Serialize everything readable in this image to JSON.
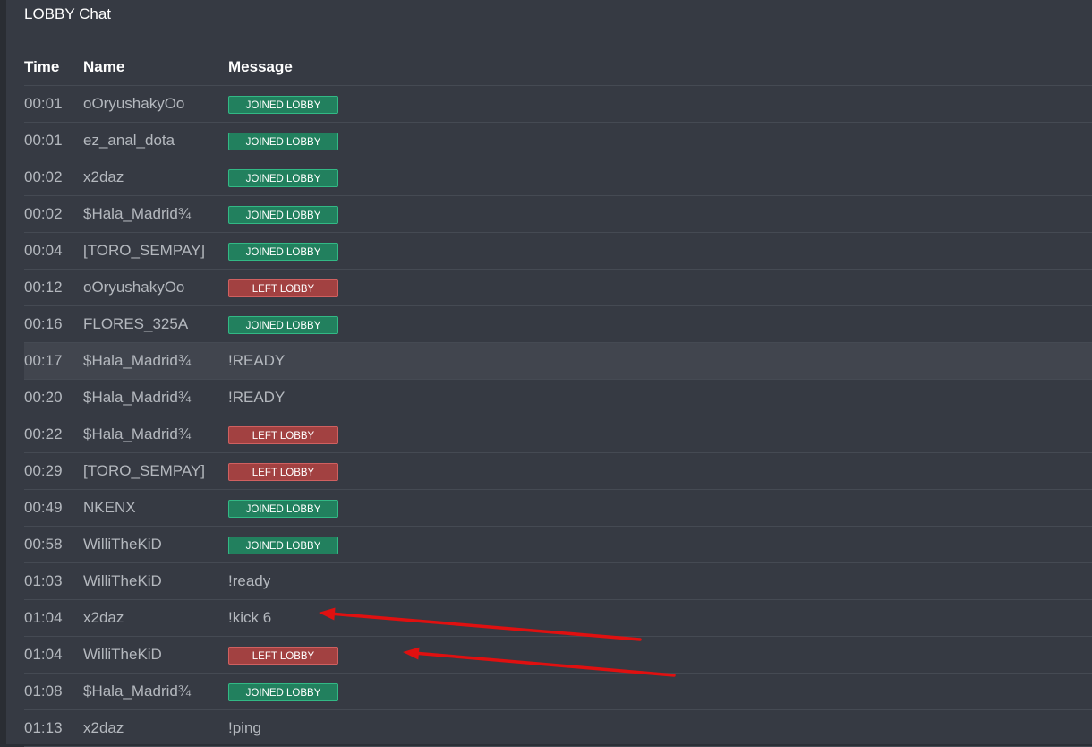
{
  "panel": {
    "title": "LOBBY Chat"
  },
  "table": {
    "headers": {
      "time": "Time",
      "name": "Name",
      "message": "Message"
    },
    "rows": [
      {
        "time": "00:01",
        "name": "oOryushakyOo",
        "message": "JOINED LOBBY",
        "type": "joined"
      },
      {
        "time": "00:01",
        "name": "ez_anal_dota",
        "message": "JOINED LOBBY",
        "type": "joined"
      },
      {
        "time": "00:02",
        "name": "x2daz",
        "message": "JOINED LOBBY",
        "type": "joined"
      },
      {
        "time": "00:02",
        "name": "$Hala_Madrid¾",
        "message": "JOINED LOBBY",
        "type": "joined"
      },
      {
        "time": "00:04",
        "name": "[TORO_SEMPAY]",
        "message": "JOINED LOBBY",
        "type": "joined"
      },
      {
        "time": "00:12",
        "name": "oOryushakyOo",
        "message": "LEFT LOBBY",
        "type": "left"
      },
      {
        "time": "00:16",
        "name": "FLORES_325A",
        "message": "JOINED LOBBY",
        "type": "joined"
      },
      {
        "time": "00:17",
        "name": "$Hala_Madrid¾",
        "message": "!READY",
        "type": "text",
        "highlight": true
      },
      {
        "time": "00:20",
        "name": "$Hala_Madrid¾",
        "message": "!READY",
        "type": "text"
      },
      {
        "time": "00:22",
        "name": "$Hala_Madrid¾",
        "message": "LEFT LOBBY",
        "type": "left"
      },
      {
        "time": "00:29",
        "name": "[TORO_SEMPAY]",
        "message": "LEFT LOBBY",
        "type": "left"
      },
      {
        "time": "00:49",
        "name": "NKENX",
        "message": "JOINED LOBBY",
        "type": "joined"
      },
      {
        "time": "00:58",
        "name": "WilliTheKiD",
        "message": "JOINED LOBBY",
        "type": "joined"
      },
      {
        "time": "01:03",
        "name": "WilliTheKiD",
        "message": "!ready",
        "type": "text"
      },
      {
        "time": "01:04",
        "name": "x2daz",
        "message": "!kick 6",
        "type": "text"
      },
      {
        "time": "01:04",
        "name": "WilliTheKiD",
        "message": "LEFT LOBBY",
        "type": "left"
      },
      {
        "time": "01:08",
        "name": "$Hala_Madrid¾",
        "message": "JOINED LOBBY",
        "type": "joined"
      },
      {
        "time": "01:13",
        "name": "x2daz",
        "message": "!ping",
        "type": "text"
      }
    ]
  },
  "annotations": {
    "arrow_color": "#e01010"
  },
  "colors": {
    "joined_badge": "#22805e",
    "left_badge": "#a24141"
  }
}
